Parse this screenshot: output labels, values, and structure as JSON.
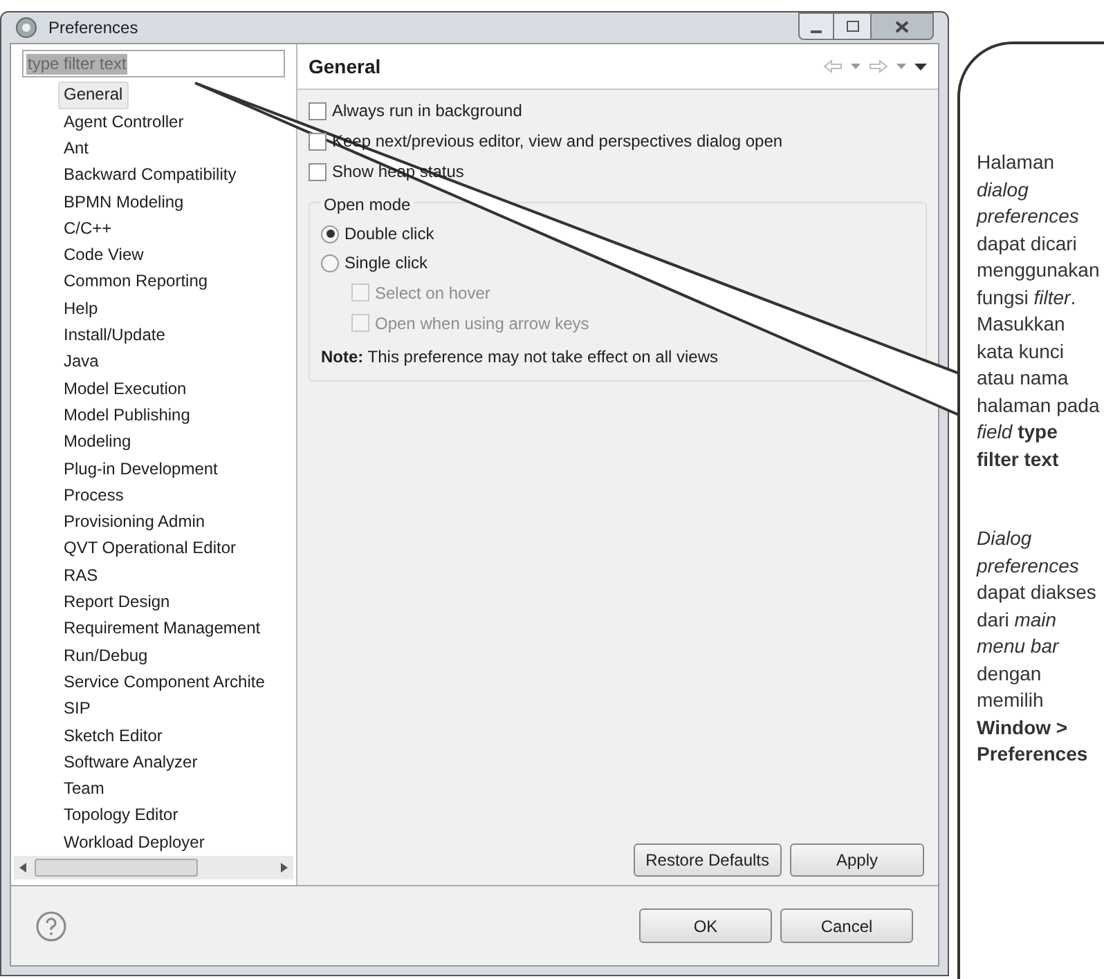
{
  "window": {
    "title": "Preferences"
  },
  "filter": {
    "value": "type filter text",
    "selected": true
  },
  "tree": {
    "items": [
      {
        "label": "General",
        "selected": true
      },
      {
        "label": "Agent Controller",
        "selected": false
      },
      {
        "label": "Ant",
        "selected": false
      },
      {
        "label": "Backward Compatibility",
        "selected": false
      },
      {
        "label": "BPMN Modeling",
        "selected": false
      },
      {
        "label": "C/C++",
        "selected": false
      },
      {
        "label": "Code View",
        "selected": false
      },
      {
        "label": "Common Reporting",
        "selected": false
      },
      {
        "label": "Help",
        "selected": false
      },
      {
        "label": "Install/Update",
        "selected": false
      },
      {
        "label": "Java",
        "selected": false
      },
      {
        "label": "Model Execution",
        "selected": false
      },
      {
        "label": "Model Publishing",
        "selected": false
      },
      {
        "label": "Modeling",
        "selected": false
      },
      {
        "label": "Plug-in Development",
        "selected": false
      },
      {
        "label": "Process",
        "selected": false
      },
      {
        "label": "Provisioning Admin",
        "selected": false
      },
      {
        "label": "QVT Operational Editor",
        "selected": false
      },
      {
        "label": "RAS",
        "selected": false
      },
      {
        "label": "Report Design",
        "selected": false
      },
      {
        "label": "Requirement Management",
        "selected": false
      },
      {
        "label": "Run/Debug",
        "selected": false
      },
      {
        "label": "Service Component Archite",
        "selected": false
      },
      {
        "label": "SIP",
        "selected": false
      },
      {
        "label": "Sketch Editor",
        "selected": false
      },
      {
        "label": "Software Analyzer",
        "selected": false
      },
      {
        "label": "Team",
        "selected": false
      },
      {
        "label": "Topology Editor",
        "selected": false
      },
      {
        "label": "Workload Deployer",
        "selected": false
      }
    ]
  },
  "page": {
    "title": "General",
    "options": [
      {
        "label": "Always run in background",
        "checked": false
      },
      {
        "label": "Keep next/previous editor, view and perspectives dialog open",
        "checked": false
      },
      {
        "label": "Show heap status",
        "checked": false
      }
    ],
    "group": {
      "title": "Open mode",
      "radios": [
        {
          "label": "Double click",
          "selected": true
        },
        {
          "label": "Single click",
          "selected": false
        }
      ],
      "sub_options": [
        {
          "label": "Select on hover",
          "checked": false,
          "disabled": true
        },
        {
          "label": "Open when using arrow keys",
          "checked": false,
          "disabled": true
        }
      ],
      "note": "**Note:** This preference may not take effect on all views"
    },
    "buttons": [
      "Restore Defaults",
      "Apply"
    ]
  },
  "footer": {
    "buttons": [
      "OK",
      "Cancel"
    ]
  },
  "callout": {
    "paragraphs": [
      "Halaman *dialog preferences* dapat dicari menggunakan fungsi *filter*. Masukkan kata kunci atau nama halaman pada *field* **type filter text**",
      "*Dialog preferences* dapat diakses dari *main menu bar* dengan memilih **Window > Preferences**"
    ]
  }
}
